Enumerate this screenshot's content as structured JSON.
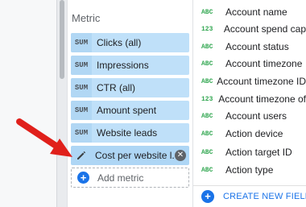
{
  "metric_panel": {
    "title": "Metric",
    "metrics": [
      {
        "aggregation": "SUM",
        "label": "Clicks (all)"
      },
      {
        "aggregation": "SUM",
        "label": "Impressions"
      },
      {
        "aggregation": "SUM",
        "label": "CTR (all)"
      },
      {
        "aggregation": "SUM",
        "label": "Amount spent"
      },
      {
        "aggregation": "SUM",
        "label": "Website leads"
      }
    ],
    "selected_metric": {
      "label": "Cost per website l...",
      "icon": "pencil-icon",
      "remove_icon": "close-icon"
    },
    "add_metric_label": "Add metric"
  },
  "fields_panel": {
    "fields": [
      {
        "type": "ABC",
        "name": "Account name"
      },
      {
        "type": "123",
        "name": "Account spend cap"
      },
      {
        "type": "ABC",
        "name": "Account status"
      },
      {
        "type": "ABC",
        "name": "Account timezone"
      },
      {
        "type": "ABC",
        "name": "Account timezone ID"
      },
      {
        "type": "123",
        "name": "Account timezone of"
      },
      {
        "type": "ABC",
        "name": "Account users"
      },
      {
        "type": "ABC",
        "name": "Action device"
      },
      {
        "type": "ABC",
        "name": "Action target ID"
      },
      {
        "type": "ABC",
        "name": "Action type"
      }
    ],
    "create_new_field_label": "CREATE NEW FIELD"
  },
  "colors": {
    "chip_bg": "#bfe0f9",
    "accent_blue": "#1a73e8",
    "type_green": "#34a853",
    "annotation_red": "#e0201b"
  }
}
